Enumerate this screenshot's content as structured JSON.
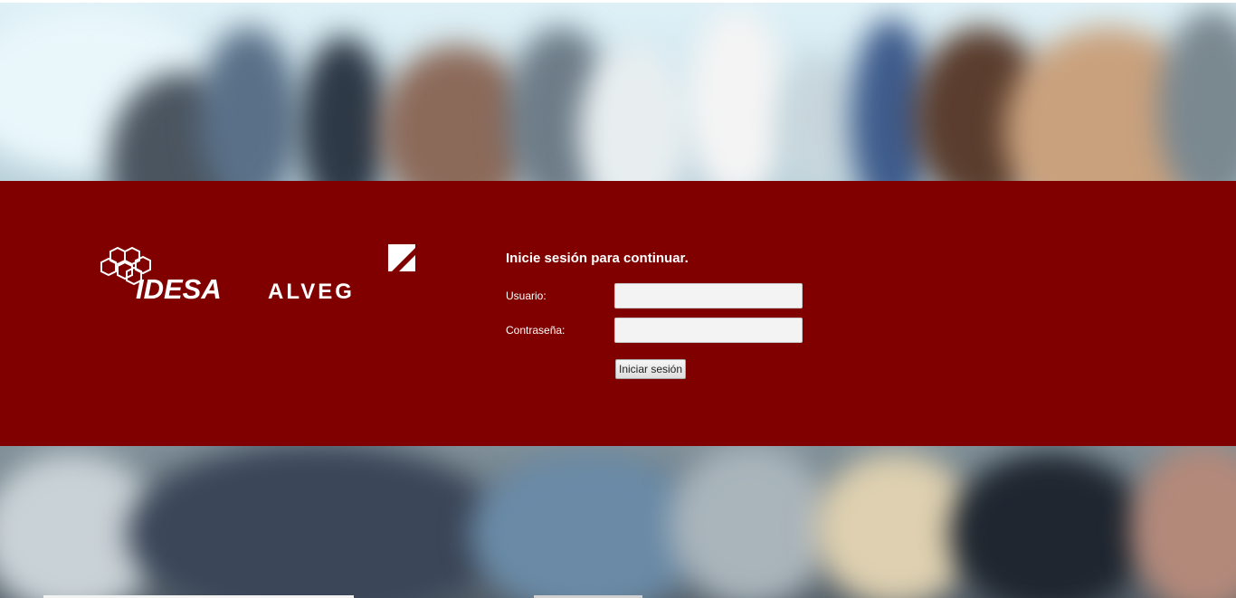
{
  "brand": {
    "logo_idesa": "IDESA",
    "logo_alveg": "ALVEG"
  },
  "login": {
    "title": "Inicie sesión para continuar.",
    "username_label": "Usuario:",
    "username_value": "",
    "password_label": "Contraseña:",
    "password_value": "",
    "submit_label": "Iniciar sesión"
  },
  "colors": {
    "band": "#800000",
    "text": "#ffffff"
  }
}
